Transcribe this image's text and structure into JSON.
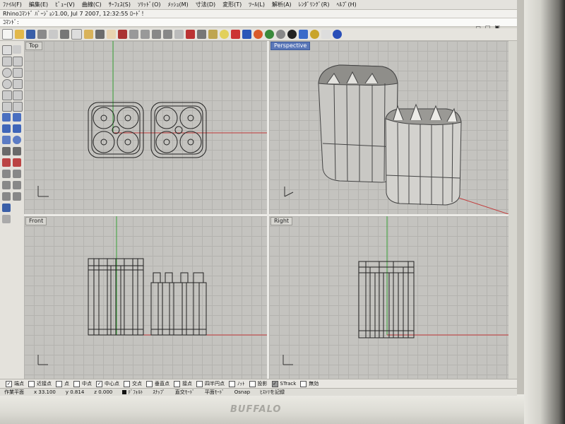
{
  "menu": [
    "ﾌｧｲﾙ(F)",
    "編集(E)",
    "ﾋﾞｭｰ(V)",
    "曲線(C)",
    "ｻｰﾌｪｽ(S)",
    "ｿﾘｯﾄﾞ(O)",
    "ﾒｯｼｭ(M)",
    "寸法(D)",
    "変形(T)",
    "ﾂｰﾙ(L)",
    "解析(A)",
    "ﾚﾝﾀﾞﾘﾝｸﾞ(R)",
    "ﾍﾙﾌﾟ(H)"
  ],
  "title_text": "Rhinoｺﾏﾝﾄﾞ ﾊﾞｰｼﾞｮﾝ1.00, Jul 7 2007, 12:32:55 ﾛｰﾄﾞ！",
  "command_label": "ｺﾏﾝﾄﾞ:",
  "viewports": {
    "top": "Top",
    "perspective": "Perspective",
    "front": "Front",
    "right": "Right"
  },
  "osnap": [
    {
      "label": "端点",
      "checked": true
    },
    {
      "label": "近接点",
      "checked": false
    },
    {
      "label": "点",
      "checked": false
    },
    {
      "label": "中点",
      "checked": false
    },
    {
      "label": "中心点",
      "checked": true
    },
    {
      "label": "交点",
      "checked": false
    },
    {
      "label": "垂直点",
      "checked": false
    },
    {
      "label": "接点",
      "checked": false
    },
    {
      "label": "四半円点",
      "checked": false
    },
    {
      "label": "ﾉｯﾄ",
      "checked": false
    },
    {
      "label": "投影",
      "checked": false
    },
    {
      "label": "STrack",
      "checked": true
    },
    {
      "label": "無効",
      "checked": false
    }
  ],
  "status": {
    "plane": "作業平面",
    "x": "x 33.100",
    "y": "y 0.814",
    "z": "z 0.000",
    "layer": "ﾃﾞﾌｫﾙﾄ",
    "snap": "ｽﾅｯﾌﾟ",
    "ortho": "直交ﾓｰﾄﾞ",
    "planar": "平面ﾓｰﾄﾞ",
    "osnap": "Osnap",
    "history": "ﾋｽﾄﾘを記録"
  },
  "brand": "BUFFALO",
  "colors": {
    "viewport_bg": "#c4c3bf",
    "grid_line": "#b4b3af",
    "x_axis": "#c23a3a",
    "y_axis": "#3aa33a",
    "active_tab": "#5a77b8"
  }
}
